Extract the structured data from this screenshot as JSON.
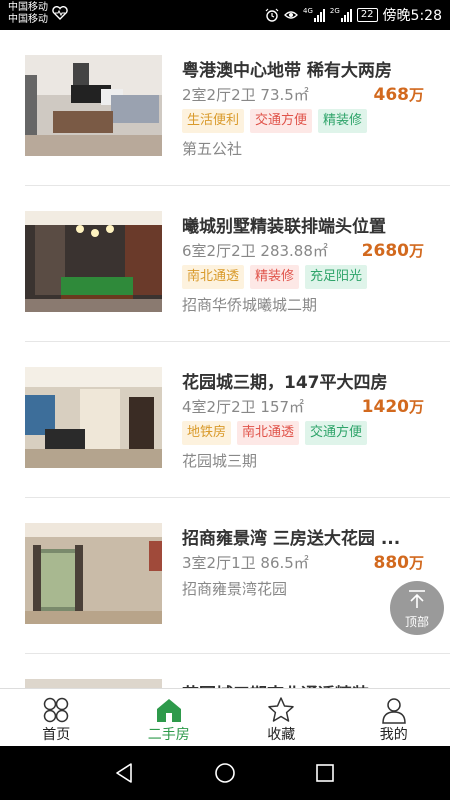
{
  "status_bar": {
    "carrier_1": "中国移动",
    "carrier_2": "中国移动",
    "network_1": "4G",
    "network_2": "2G",
    "battery": "22",
    "time": "傍晚5:28"
  },
  "listings": [
    {
      "title": "粤港澳中心地带 稀有大两房",
      "spec": "2室2厅2卫 73.5㎡",
      "price": "468",
      "price_unit": "万",
      "tags": [
        {
          "label": "生活便利",
          "style": "orange"
        },
        {
          "label": "交通方便",
          "style": "red"
        },
        {
          "label": "精装修",
          "style": "green"
        }
      ],
      "community": "第五公社"
    },
    {
      "title": "曦城别墅精装联排端头位置",
      "spec": "6室2厅2卫 283.88㎡",
      "price": "2680",
      "price_unit": "万",
      "tags": [
        {
          "label": "南北通透",
          "style": "orange"
        },
        {
          "label": "精装修",
          "style": "red"
        },
        {
          "label": "充足阳光",
          "style": "green"
        }
      ],
      "community": "招商华侨城曦城二期"
    },
    {
      "title": "花园城三期，147平大四房",
      "spec": "4室2厅2卫 157㎡",
      "price": "1420",
      "price_unit": "万",
      "tags": [
        {
          "label": "地铁房",
          "style": "orange"
        },
        {
          "label": "南北通透",
          "style": "red"
        },
        {
          "label": "交通方便",
          "style": "green"
        }
      ],
      "community": "花园城三期"
    },
    {
      "title": "招商雍景湾 三房送大花园 ...",
      "spec": "3室2厅1卫 86.5㎡",
      "price": "880",
      "price_unit": "万",
      "tags": [],
      "community": "招商雍景湾花园"
    },
    {
      "title": "花园城三期南北通透精装",
      "spec": "",
      "price": "",
      "price_unit": "",
      "tags": [],
      "community": ""
    }
  ],
  "back_to_top": {
    "label": "顶部"
  },
  "bottom_nav": [
    {
      "label": "首页",
      "icon": "home-grid-icon",
      "active": false
    },
    {
      "label": "二手房",
      "icon": "house-icon",
      "active": true
    },
    {
      "label": "收藏",
      "icon": "star-icon",
      "active": false
    },
    {
      "label": "我的",
      "icon": "user-icon",
      "active": false
    }
  ],
  "colors": {
    "accent_green": "#2e9a4b",
    "price_orange": "#d2691e",
    "tag_orange": "#d99a2b",
    "tag_red": "#e0534a",
    "tag_green": "#2fa46a"
  }
}
